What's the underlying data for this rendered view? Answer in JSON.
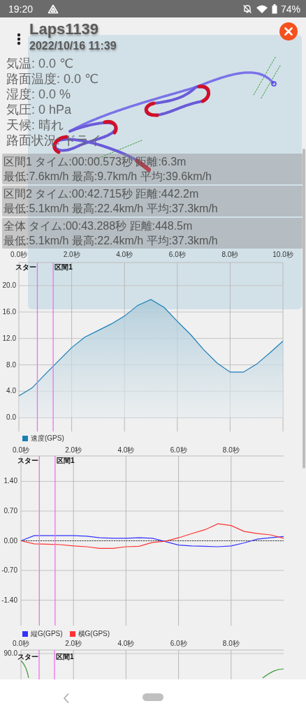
{
  "status_bar": {
    "time": "19:20",
    "battery": "74%"
  },
  "header": {
    "title": "Laps1139",
    "date": "2022/10/16 11:39"
  },
  "conditions": [
    "気温: 0.0 ℃",
    "路面温度: 0.0 ℃",
    "湿度: 0.0 %",
    "気圧: 0 hPa",
    "天候: 晴れ",
    "路面状況: ドライ"
  ],
  "sections": [
    {
      "lines": [
        "区間1 タイム:00:00.573秒 距離:6.3m",
        "最低:7.6km/h 最高:9.7km/h 平均:39.6km/h"
      ]
    },
    {
      "lines": [
        "区間2 タイム:00:42.715秒 距離:442.2m",
        "最低:5.1km/h 最高:22.4km/h 平均:37.3km/h"
      ]
    },
    {
      "lines": [
        "全体  タイム:00:43.288秒 距離:448.5m",
        "最低:5.1km/h 最高:22.4km/h 平均:37.3km/h"
      ]
    }
  ],
  "charts": [
    {
      "chart_data": {
        "type": "area",
        "x": [
          0,
          0.5,
          1,
          1.5,
          2,
          2.5,
          3,
          3.5,
          4,
          4.5,
          5,
          5.5,
          6,
          6.5,
          7,
          7.5,
          8,
          8.5,
          9,
          9.5,
          10
        ],
        "series": [
          {
            "name": "速度(GPS)",
            "color": "#1a7fb8",
            "values": [
              3.3,
              4.5,
              6.6,
              8.6,
              10.6,
              12.2,
              13.2,
              14.2,
              15.4,
              17.0,
              17.9,
              16.7,
              14.6,
              12.6,
              10.3,
              8.3,
              6.9,
              6.9,
              8.1,
              9.8,
              11.6
            ]
          }
        ],
        "xlim": [
          0,
          10
        ],
        "ylim": [
          -2.1,
          23.5
        ],
        "xticks": [
          {
            "value": 0,
            "label": "0.0秒"
          },
          {
            "value": 2,
            "label": "2.0秒"
          },
          {
            "value": 4,
            "label": "4.0秒"
          },
          {
            "value": 6,
            "label": "6.0秒"
          },
          {
            "value": 8,
            "label": "8.0秒"
          },
          {
            "value": 10,
            "label": "10.0秒"
          }
        ],
        "yticks": [
          {
            "value": 0,
            "label": "0.0"
          },
          {
            "value": 4,
            "label": "4.0"
          },
          {
            "value": 8,
            "label": "8.0"
          },
          {
            "value": 12,
            "label": "12.0"
          },
          {
            "value": 16,
            "label": "16.0"
          },
          {
            "value": 20,
            "label": "20.0"
          }
        ],
        "grid": true,
        "ref_lines": [
          {
            "axis": "x",
            "value": 0.7,
            "label": "スター"
          },
          {
            "axis": "x",
            "value": 1.3,
            "label": "区間1"
          }
        ]
      }
    },
    {
      "chart_data": {
        "type": "line",
        "x": [
          0,
          0.5,
          1,
          1.5,
          2,
          2.5,
          3,
          3.5,
          4,
          4.5,
          5,
          5.5,
          6,
          6.5,
          7,
          7.5,
          8,
          8.5,
          9,
          9.5,
          10
        ],
        "series": [
          {
            "name": "縦G(GPS)",
            "color": "#3333ff",
            "values": [
              0.0,
              0.12,
              0.12,
              0.12,
              0.12,
              0.11,
              0.07,
              0.06,
              0.06,
              0.07,
              0.06,
              -0.02,
              -0.1,
              -0.12,
              -0.13,
              -0.14,
              -0.12,
              -0.05,
              0.04,
              0.07,
              0.1
            ]
          },
          {
            "name": "横G(GPS)",
            "color": "#ff3333",
            "values": [
              0.0,
              -0.07,
              -0.08,
              -0.09,
              -0.12,
              -0.14,
              -0.18,
              -0.18,
              -0.14,
              -0.13,
              -0.04,
              -0.01,
              0.07,
              0.17,
              0.26,
              0.4,
              0.36,
              0.22,
              0.17,
              0.14,
              0.06
            ]
          }
        ],
        "xlim": [
          0,
          10
        ],
        "ylim": [
          -2,
          2
        ],
        "xticks": [
          {
            "value": 0,
            "label": "0.0秒"
          },
          {
            "value": 2,
            "label": "2.0秒"
          },
          {
            "value": 4,
            "label": "4.0秒"
          },
          {
            "value": 6,
            "label": "6.0秒"
          },
          {
            "value": 8,
            "label": "8.0秒"
          }
        ],
        "yticks": [
          {
            "value": -1.4,
            "label": "-1.40"
          },
          {
            "value": -0.7,
            "label": "-0.70"
          },
          {
            "value": 0,
            "label": "0.00"
          },
          {
            "value": 0.7,
            "label": "0.70"
          },
          {
            "value": 1.4,
            "label": "1.40"
          }
        ],
        "grid": true,
        "ref_lines": [
          {
            "axis": "x",
            "value": 0.7,
            "label": "スター"
          },
          {
            "axis": "x",
            "value": 1.3,
            "label": "区間1"
          },
          {
            "axis": "y",
            "value": 0
          }
        ]
      }
    }
  ],
  "partial_chart": {
    "xticks": [
      "0.0秒",
      "2.0秒",
      "4.0秒",
      "6.0秒",
      "8.0秒"
    ],
    "ytick": "90.0",
    "markers": [
      "スター",
      "区間1"
    ]
  }
}
